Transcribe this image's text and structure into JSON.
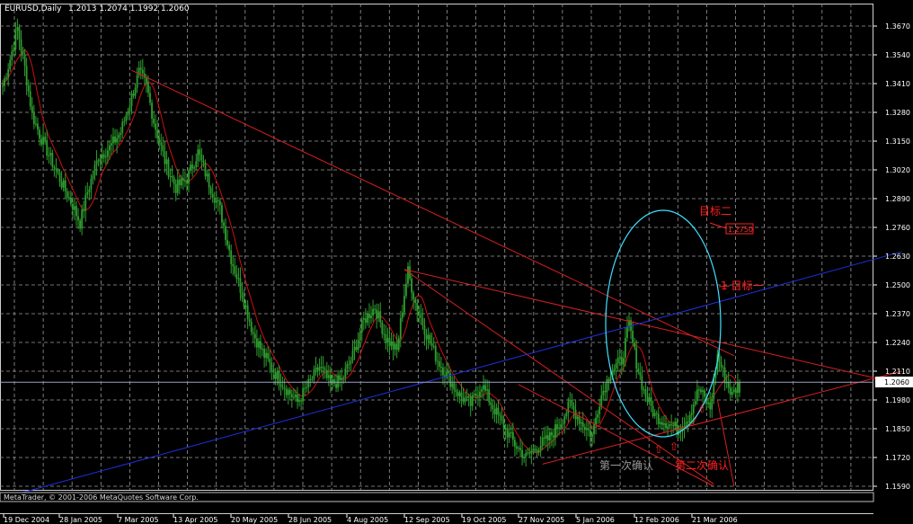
{
  "header": {
    "symbol": "EURUSD,Daily",
    "ohlc": "1.2013 1.2074 1.1992 1.2060"
  },
  "copyright": "MetaTrader, © 2001-2006 MetaQuotes Software Corp.",
  "current_price_label": "1.2060",
  "annotations": {
    "target_two": "目标二",
    "target_one": "1 目标一",
    "target_price_box": "1.2750",
    "first_confirm": "第一次确认",
    "second_confirm": "第二次确认",
    "up_arrow": "⇧"
  },
  "colors": {
    "background": "#000000",
    "grid": "#9a9a9a",
    "candle": "#2e9e2e",
    "moving_average": "#cc1010",
    "trendline_red": "#d42020",
    "trendline_blue": "#2030e0",
    "ellipse": "#40e0ff",
    "price_line": "#9aa0c0"
  },
  "chart_data": {
    "type": "candlestick",
    "symbol": "EURUSD",
    "timeframe": "Daily",
    "y_ticks": [
      "1.3670",
      "1.3540",
      "1.3410",
      "1.3280",
      "1.3150",
      "1.3020",
      "1.2890",
      "1.2760",
      "1.2630",
      "1.2500",
      "1.2370",
      "1.2240",
      "1.2110",
      "1.1980",
      "1.1850",
      "1.1720",
      "1.1590"
    ],
    "x_ticks": [
      "19 Dec 2004",
      "28 Jan 2005",
      "7 Mar 2005",
      "13 Apr 2005",
      "20 May 2005",
      "28 Jun 2005",
      "4 Aug 2005",
      "12 Sep 2005",
      "19 Oct 2005",
      "27 Nov 2005",
      "5 Jan 2006",
      "12 Feb 2006",
      "21 Mar 2006"
    ],
    "ylim": [
      1.159,
      1.367
    ],
    "current_price": 1.206,
    "last_bar": {
      "open": 1.2013,
      "high": 1.2074,
      "low": 1.1992,
      "close": 1.206
    },
    "price_path": [
      [
        0,
        1.34
      ],
      [
        4,
        1.352
      ],
      [
        8,
        1.366
      ],
      [
        12,
        1.348
      ],
      [
        16,
        1.327
      ],
      [
        20,
        1.318
      ],
      [
        26,
        1.307
      ],
      [
        32,
        1.296
      ],
      [
        38,
        1.286
      ],
      [
        42,
        1.278
      ],
      [
        46,
        1.292
      ],
      [
        52,
        1.308
      ],
      [
        58,
        1.312
      ],
      [
        64,
        1.319
      ],
      [
        70,
        1.335
      ],
      [
        74,
        1.346
      ],
      [
        78,
        1.34
      ],
      [
        82,
        1.324
      ],
      [
        88,
        1.306
      ],
      [
        94,
        1.294
      ],
      [
        100,
        1.298
      ],
      [
        106,
        1.31
      ],
      [
        112,
        1.296
      ],
      [
        118,
        1.284
      ],
      [
        124,
        1.262
      ],
      [
        130,
        1.246
      ],
      [
        136,
        1.228
      ],
      [
        142,
        1.218
      ],
      [
        148,
        1.21
      ],
      [
        154,
        1.203
      ],
      [
        160,
        1.197
      ],
      [
        166,
        1.205
      ],
      [
        172,
        1.213
      ],
      [
        178,
        1.205
      ],
      [
        184,
        1.207
      ],
      [
        190,
        1.218
      ],
      [
        196,
        1.234
      ],
      [
        202,
        1.24
      ],
      [
        208,
        1.226
      ],
      [
        214,
        1.22
      ],
      [
        218,
        1.246
      ],
      [
        220,
        1.256
      ],
      [
        224,
        1.242
      ],
      [
        230,
        1.228
      ],
      [
        236,
        1.216
      ],
      [
        242,
        1.208
      ],
      [
        248,
        1.2
      ],
      [
        254,
        1.196
      ],
      [
        260,
        1.205
      ],
      [
        266,
        1.195
      ],
      [
        272,
        1.186
      ],
      [
        278,
        1.178
      ],
      [
        284,
        1.172
      ],
      [
        290,
        1.177
      ],
      [
        296,
        1.18
      ],
      [
        302,
        1.187
      ],
      [
        308,
        1.196
      ],
      [
        314,
        1.188
      ],
      [
        320,
        1.182
      ],
      [
        324,
        1.198
      ],
      [
        330,
        1.211
      ],
      [
        336,
        1.216
      ],
      [
        340,
        1.232
      ],
      [
        344,
        1.215
      ],
      [
        348,
        1.202
      ],
      [
        354,
        1.191
      ],
      [
        360,
        1.188
      ],
      [
        366,
        1.185
      ],
      [
        372,
        1.19
      ],
      [
        378,
        1.203
      ],
      [
        384,
        1.194
      ],
      [
        388,
        1.218
      ],
      [
        392,
        1.208
      ],
      [
        396,
        1.2
      ],
      [
        400,
        1.206
      ]
    ],
    "trendlines": [
      {
        "color": "red",
        "from": [
          70,
          1.347
        ],
        "to": [
          397,
          1.218
        ]
      },
      {
        "color": "red",
        "from": [
          218,
          1.257
        ],
        "to": [
          494,
          1.204
        ]
      },
      {
        "color": "red",
        "from": [
          218,
          1.257
        ],
        "to": [
          386,
          1.16
        ]
      },
      {
        "color": "red",
        "from": [
          293,
          1.169
        ],
        "to": [
          488,
          1.211
        ]
      },
      {
        "color": "red",
        "from": [
          280,
          1.205
        ],
        "to": [
          386,
          1.159
        ]
      },
      {
        "color": "red",
        "from": [
          388,
          1.198
        ],
        "to": [
          397,
          1.159
        ]
      },
      {
        "color": "blue",
        "from": [
          10,
          1.156
        ],
        "to": [
          488,
          1.265
        ]
      }
    ]
  }
}
